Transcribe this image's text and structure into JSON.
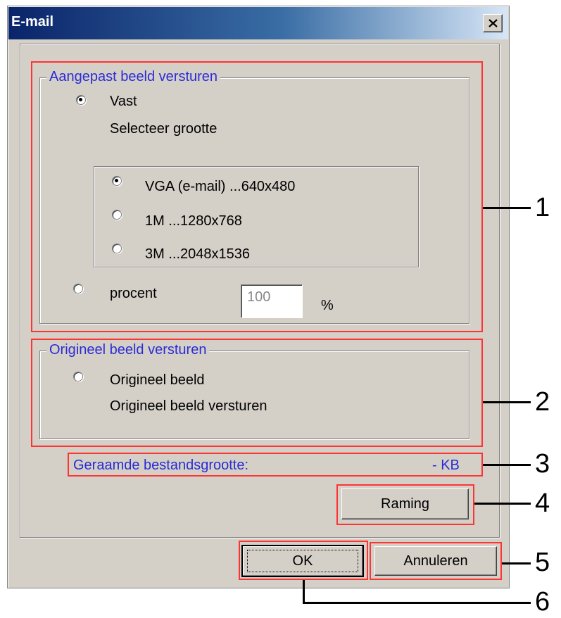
{
  "window": {
    "title": "E-mail"
  },
  "custom": {
    "legend": "Aangepast beeld versturen",
    "fixed_label": "Vast",
    "select_size": "Selecteer grootte",
    "sizes": [
      "VGA (e-mail) ...640x480",
      "1M ...1280x768",
      "3M ...2048x1536"
    ],
    "selected_size": 0,
    "percent_label": "procent",
    "percent_value": "100",
    "percent_unit": "%"
  },
  "original": {
    "legend": "Origineel beeld versturen",
    "radio_label": "Origineel beeld",
    "description": "Origineel beeld versturen"
  },
  "estimate": {
    "label": "Geraamde bestandsgrootte:",
    "value": "- KB",
    "button": "Raming"
  },
  "footer": {
    "ok": "OK",
    "cancel": "Annuleren"
  },
  "callouts": [
    "1",
    "2",
    "3",
    "4",
    "5",
    "6"
  ],
  "colors": {
    "highlight": "#ff3333",
    "legend_text": "#2b2bd6",
    "title_bar": "#0a246a"
  }
}
